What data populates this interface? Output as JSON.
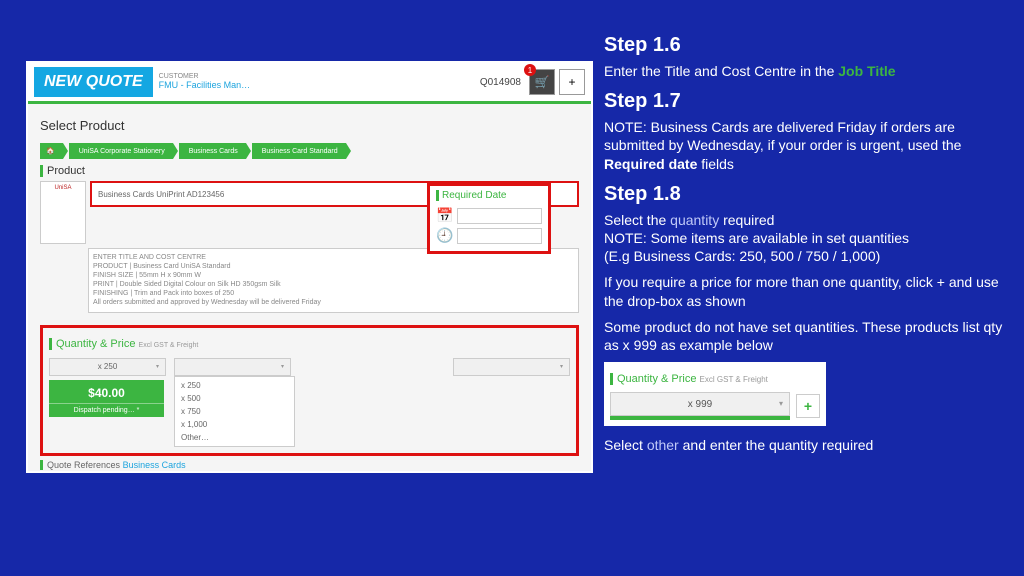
{
  "app": {
    "new_quote": "NEW QUOTE",
    "customer_label": "CUSTOMER",
    "customer_name": "FMU - Facilities Man…",
    "quote_number": "Q014908",
    "cart_badge": "1",
    "plus": "+"
  },
  "main": {
    "select_product": "Select Product",
    "breadcrumb": [
      "🏠",
      "UniSA Corporate Stationery",
      "Business Cards",
      "Business Card Standard"
    ],
    "product_heading": "Product",
    "thumb_text": "UniSA",
    "title_input": "Business Cards UniPrint AD123456",
    "desc": [
      "ENTER TITLE AND COST CENTRE",
      "",
      "PRODUCT | Business Card UniSA Standard",
      "FINISH SIZE | 55mm H x 90mm W",
      "PRINT | Double Sided Digital Colour on Silk HD 350gsm Silk",
      "FINISHING | Trim and Pack into boxes of 250",
      "",
      "All orders submitted and approved by Wednesday will be delivered Friday"
    ],
    "required_date": "Required Date"
  },
  "qp": {
    "heading": "Quantity & Price",
    "sub": "Excl GST & Freight",
    "selected_qty": "x 250",
    "price": "$40.00",
    "dispatch": "Dispatch pending… *",
    "options": [
      "x 250",
      "x 500",
      "x 750",
      "x 1,000",
      "Other…"
    ],
    "refs": "Quote References",
    "refs_link": "Business Cards"
  },
  "mini": {
    "heading": "Quantity & Price",
    "sub": "Excl GST & Freight",
    "qty": "x 999",
    "plus": "+"
  },
  "instr": {
    "s16": "Step 1.6",
    "s16_text_a": "Enter the Title and Cost Centre in the ",
    "s16_jt": "Job Title",
    "s17": "Step 1.7",
    "s17_text_a": "NOTE: Business Cards are delivered Friday if orders are submitted by Wednesday, if your order is urgent, used the ",
    "s17_rd": "Required date",
    "s17_text_b": " fields",
    "s18": "Step 1.8",
    "s18_l1a": "Select the ",
    "s18_qty": "quantity",
    "s18_l1b": " required",
    "s18_l2": "NOTE: Some items are available in set quantities",
    "s18_l3": "(E.g Business Cards: 250, 500 / 750 / 1,000)",
    "s18_p2": "If you require a price for more than one quantity, click + and use the drop-box as shown",
    "s18_p3": "Some product do not have set quantities. These products list qty as x 999 as example below",
    "s18_p4a": "Select ",
    "s18_other": "other",
    "s18_p4b": " and enter the quantity required"
  }
}
